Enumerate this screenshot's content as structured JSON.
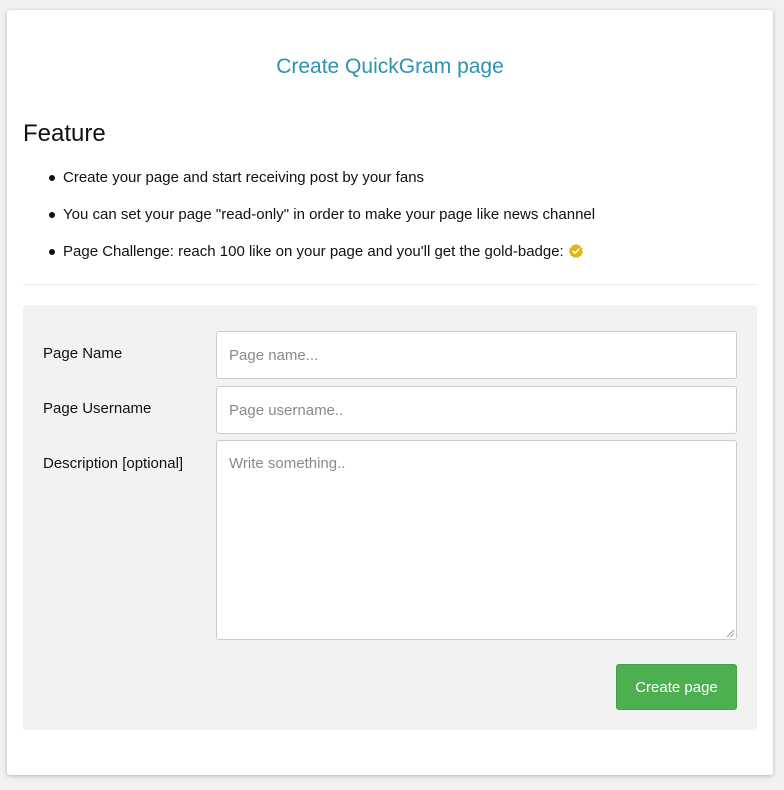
{
  "header": {
    "title": "Create QuickGram page"
  },
  "feature": {
    "heading": "Feature",
    "items": [
      "Create your page and start receiving post by your fans",
      "You can set your page \"read-only\" in order to make your page like news channel",
      "Page Challenge: reach 100 like on your page and you'll get the gold-badge:"
    ],
    "badge_icon": "gold-badge-icon",
    "badge_color": "#e0b50c"
  },
  "form": {
    "page_name": {
      "label": "Page Name",
      "value": "",
      "placeholder": "Page name..."
    },
    "page_username": {
      "label": "Page Username",
      "value": "",
      "placeholder": "Page username.."
    },
    "description": {
      "label": "Description [optional]",
      "value": "",
      "placeholder": "Write something.."
    },
    "submit_label": "Create page"
  },
  "colors": {
    "title": "#2b93b0",
    "button": "#4caf50",
    "panel": "#f2f2f2"
  }
}
